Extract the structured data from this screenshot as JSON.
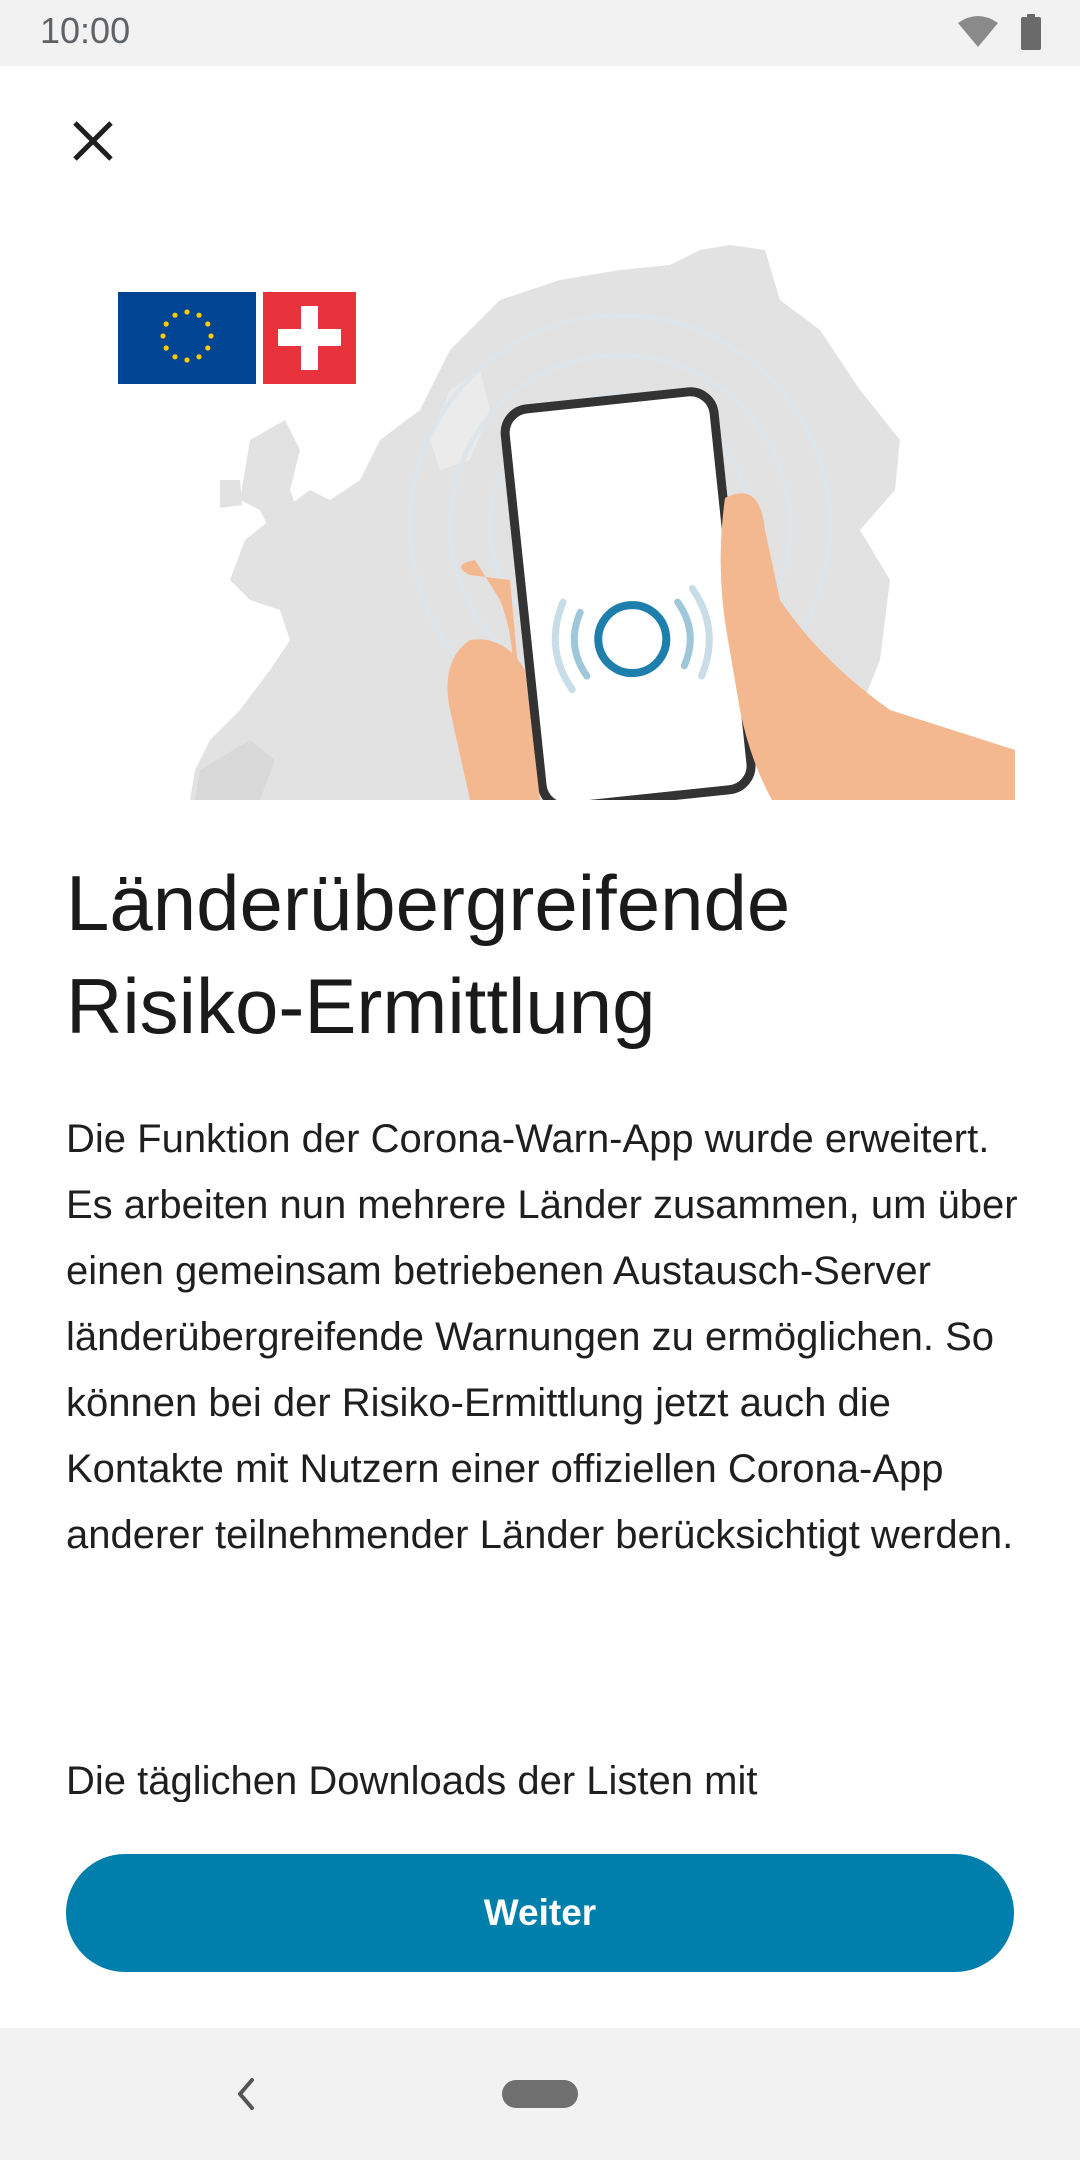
{
  "status_bar": {
    "time": "10:00",
    "icons": [
      "wifi-icon",
      "battery-icon"
    ]
  },
  "header": {
    "close_icon": "close-icon"
  },
  "illustration": {
    "description_icons": [
      "eu-flag-icon",
      "swiss-flag-icon",
      "europe-map",
      "phone-in-hand"
    ]
  },
  "main": {
    "title": "Länderübergreifende Risiko-Ermittlung",
    "paragraph_1": "Die Funktion der Corona-Warn-App wurde erweitert. Es arbeiten nun mehrere Länder zusammen, um über einen gemeinsam betriebenen Austausch-Server länderübergreifende Warnungen zu ermöglichen. So können bei der Risiko-Ermittlung jetzt auch die Kontakte mit Nutzern einer offiziellen Corona-App anderer teilnehmender Länder berücksichtigt werden.",
    "paragraph_2": "Die täglichen Downloads der Listen mit"
  },
  "footer": {
    "next_button_label": "Weiter"
  },
  "colors": {
    "primary": "#007fad",
    "eu_blue": "#004494",
    "swiss_red": "#e8323c",
    "skin": "#f4b891"
  }
}
